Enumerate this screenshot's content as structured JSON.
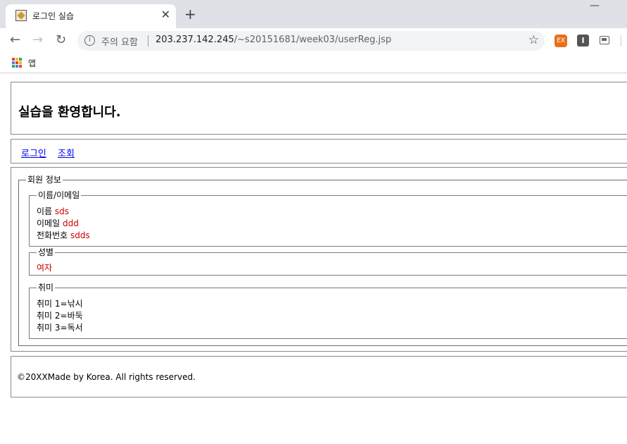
{
  "browser": {
    "tab_title": "로그인 실습",
    "tab_close": "✕",
    "new_tab": "+",
    "minimize": "—",
    "back": "←",
    "forward": "→",
    "reload": "↻",
    "info_icon": "i",
    "security_label": "주의 요함",
    "url_host": "203.237.142.245",
    "url_path": "/~s20151681/week03/userReg.jsp",
    "star": "☆",
    "ext1_label": "EX",
    "ext2_label": "I",
    "bookmarks_apps_label": "앱"
  },
  "header": {
    "title": "실습을 환영합니다."
  },
  "nav": {
    "login": "로그인",
    "view": "조회"
  },
  "member_info": {
    "legend": "회원 정보",
    "name_email": {
      "legend": "이름/이메일",
      "name_label": "이름",
      "name_value": "sds",
      "email_label": "이메일",
      "email_value": "ddd",
      "phone_label": "전화번호",
      "phone_value": "sdds"
    },
    "gender": {
      "legend": "성별",
      "value": "여자"
    },
    "hobby": {
      "legend": "취미",
      "items": [
        "취미 1=낚시",
        "취미 2=바둑",
        "취미 3=독서"
      ]
    }
  },
  "footer": {
    "text": "©20XXMade by Korea. All rights reserved."
  },
  "colors": {
    "value_red": "#cc0000",
    "link_blue": "#0000ee",
    "chrome_bg": "#dee1e6"
  }
}
